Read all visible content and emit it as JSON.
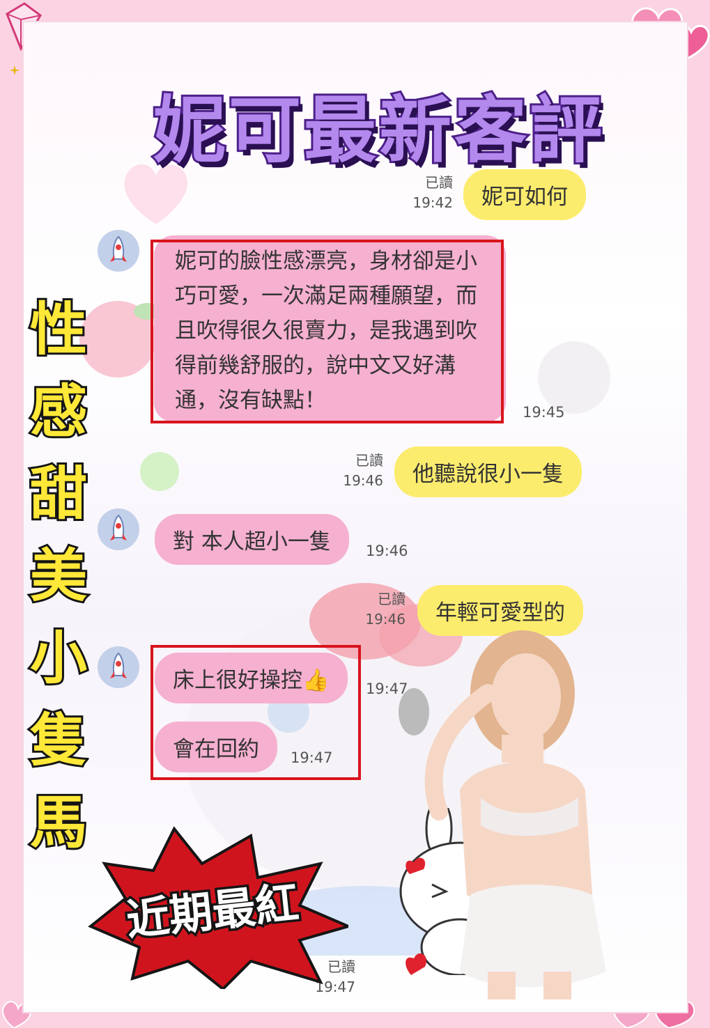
{
  "header": {
    "title": "妮可最新客評"
  },
  "side_banner": {
    "chars": [
      "性",
      "感",
      "甜",
      "美",
      "小",
      "隻",
      "馬"
    ]
  },
  "burst": {
    "text": "近期最紅"
  },
  "messages": {
    "m1": {
      "text": "妮可如何",
      "read": "已讀",
      "time": "19:42"
    },
    "m2": {
      "text": "妮可的臉性感漂亮，身材卻是小巧可愛，一次滿足兩種願望，而且吹得很久很賣力，是我遇到吹得前幾舒服的，說中文又好溝通，沒有缺點！",
      "time": "19:45"
    },
    "m3": {
      "text": "他聽說很小一隻",
      "read": "已讀",
      "time": "19:46"
    },
    "m4": {
      "text": "對 本人超小一隻",
      "time": "19:46"
    },
    "m5": {
      "text": "年輕可愛型的",
      "read": "已讀",
      "time": "19:46"
    },
    "m6": {
      "text": "床上很好操控👍",
      "time": "19:47"
    },
    "m7": {
      "text": "會在回約",
      "time": "19:47"
    },
    "m8": {
      "read": "已讀",
      "time": "19:47"
    }
  },
  "icons": [
    "rocket-icon",
    "diamond-icon",
    "heart-icon",
    "sparkle-icon"
  ],
  "colors": {
    "outgoing_bubble": "#fcec6e",
    "incoming_bubble": "#f6b0d0",
    "highlight_box": "#d8141e",
    "title_fill": "#b489ee",
    "banner_fill": "#ffe838"
  }
}
